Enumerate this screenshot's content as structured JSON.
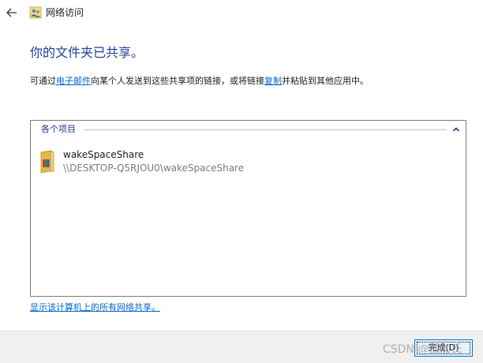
{
  "window": {
    "title": "网络访问"
  },
  "heading": "你的文件夹已共享。",
  "description": {
    "part1": "可通过",
    "email_link": "电子邮件",
    "part2": "向某个人发送到这些共享项的链接，或将链接",
    "copy_link": "复制",
    "part3": "并粘贴到其他应用中。"
  },
  "items_group": {
    "label": "各个项目"
  },
  "shared_items": [
    {
      "name": "wakeSpaceShare",
      "path": "\\\\DESKTOP-Q5RJOU0\\wakeSpaceShare"
    }
  ],
  "show_all_link": "显示该计算机上的所有网络共享。",
  "footer": {
    "done_label": "完成(D)"
  },
  "watermark": "CSDN @孤加氏",
  "colors": {
    "heading": "#1f3f99",
    "link": "#0066cc",
    "button_border": "#0078d7"
  }
}
